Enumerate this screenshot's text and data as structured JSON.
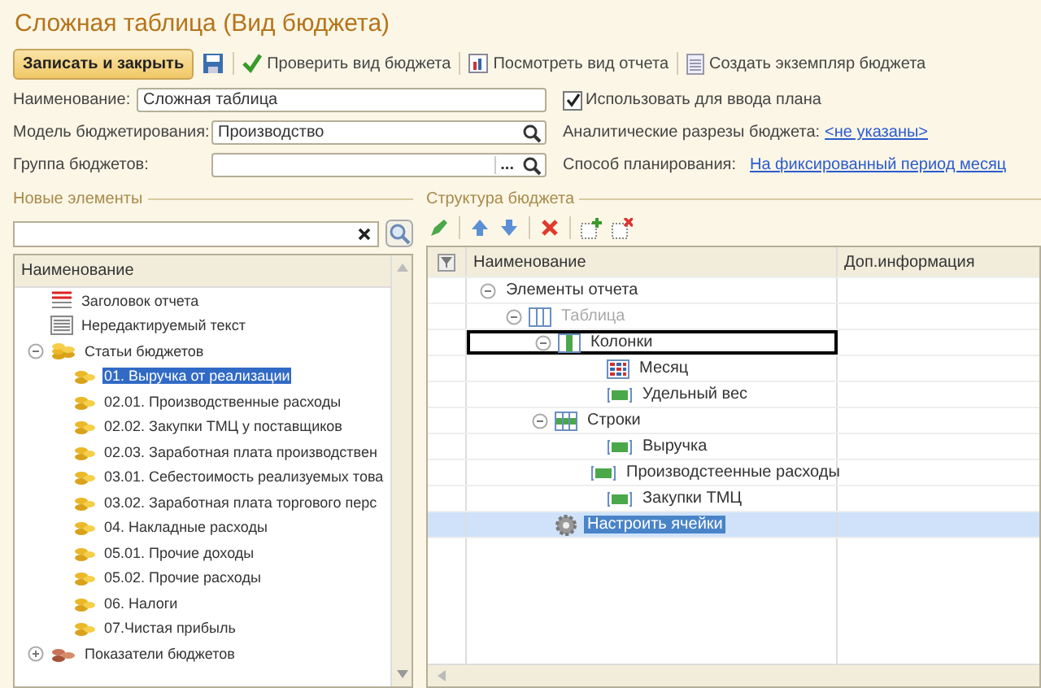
{
  "window": {
    "title": "Сложная таблица (Вид бюджета)"
  },
  "toolbar": [
    {
      "kind": "primary",
      "label": "Записать и закрыть"
    },
    {
      "kind": "save"
    },
    {
      "kind": "check",
      "label": "Проверить вид бюджета"
    },
    {
      "kind": "report",
      "label": "Посмотреть вид отчета"
    },
    {
      "kind": "doc",
      "label": "Создать экземпляр бюджета"
    }
  ],
  "form": {
    "name_label": "Наименование:",
    "name_value": "Сложная таблица",
    "use_for_plan": {
      "label": "Использовать для ввода плана",
      "checked": true
    },
    "model_label": "Модель бюджетирования:",
    "model_value": "Производство",
    "analytics_label": "Аналитические разрезы бюджета:",
    "analytics_link": "<не указаны>",
    "group_label": "Группа бюджетов:",
    "group_button": "...",
    "planning_label": "Способ планирования:",
    "planning_link": "На фиксированный период месяц"
  },
  "new_elements": {
    "title": "Новые элементы",
    "column": "Наименование",
    "items": [
      {
        "kind": "header",
        "label": "Заголовок отчета"
      },
      {
        "kind": "text",
        "label": "Нередактируемый текст"
      },
      {
        "kind": "folder",
        "label": "Статьи бюджетов",
        "expanded": true,
        "children": [
          {
            "kind": "item",
            "label": "01. Выручка от реализации",
            "selected": true
          },
          {
            "kind": "item",
            "label": "02.01. Производственные расходы",
            "selected": false
          },
          {
            "kind": "item",
            "label": "02.02. Закупки ТМЦ у поставщиков",
            "selected": false
          },
          {
            "kind": "item",
            "label": "02.03. Заработная плата производствен",
            "selected": false
          },
          {
            "kind": "item",
            "label": "03.01. Себестоимость реализуемых това",
            "selected": false
          },
          {
            "kind": "item",
            "label": "03.02. Заработная плата торгового перс",
            "selected": false
          },
          {
            "kind": "item",
            "label": "04. Накладные расходы",
            "selected": false
          },
          {
            "kind": "item",
            "label": "05.01. Прочие доходы",
            "selected": false
          },
          {
            "kind": "item",
            "label": "05.02. Прочие расходы",
            "selected": false
          },
          {
            "kind": "item",
            "label": "06. Налоги",
            "selected": false
          },
          {
            "kind": "item",
            "label": "07.Чистая прибыль",
            "selected": false
          }
        ]
      },
      {
        "kind": "indicators",
        "label": "Показатели бюджетов",
        "expanded": false
      }
    ]
  },
  "structure": {
    "title": "Структура бюджета",
    "columns": [
      "Наименование",
      "Доп.информация"
    ],
    "tree": [
      {
        "label": "Элементы отчета",
        "expanded": true,
        "disabled": false,
        "selected": false,
        "children": [
          {
            "kind": "table",
            "label": "Таблица",
            "expanded": true,
            "disabled": true,
            "selected": false,
            "children": [
              {
                "kind": "columns",
                "label": "Колонки",
                "expanded": true,
                "disabled": false,
                "selected": false,
                "drop_target": true,
                "children": [
                  {
                    "kind": "grid",
                    "label": "Месяц",
                    "disabled": false,
                    "selected": false
                  },
                  {
                    "kind": "bar",
                    "label": "Удельный вес",
                    "disabled": false,
                    "selected": false
                  }
                ]
              },
              {
                "kind": "rows",
                "label": "Строки",
                "expanded": true,
                "disabled": false,
                "selected": false,
                "children": [
                  {
                    "kind": "bar",
                    "label": "Выручка",
                    "disabled": false,
                    "selected": false
                  },
                  {
                    "kind": "bar",
                    "label": "Производстеенные расходы",
                    "disabled": false,
                    "selected": false
                  },
                  {
                    "kind": "bar",
                    "label": "Закупки ТМЦ",
                    "disabled": false,
                    "selected": false
                  }
                ]
              },
              {
                "kind": "gear",
                "label": "Настроить ячейки",
                "disabled": false,
                "selected": true
              }
            ]
          }
        ]
      }
    ]
  }
}
